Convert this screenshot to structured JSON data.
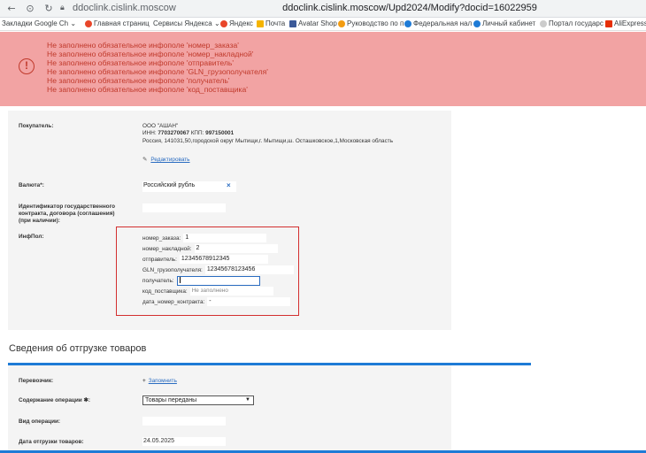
{
  "browser": {
    "url_host": "ddoclink.cislink.moscow",
    "url_full": "ddoclink.cislink.moscow/Upd2024/Modify?docid=16022959"
  },
  "bookmarks": [
    {
      "label": "Закладки Google Ch",
      "color": "#ffffff"
    },
    {
      "label": "Главная страниц",
      "color": "#e8462a"
    },
    {
      "label": "Сервисы Яндекса",
      "color": "#ffffff"
    },
    {
      "label": "Яндекс",
      "color": "#e8462a"
    },
    {
      "label": "Почта",
      "color": "#f5b400"
    },
    {
      "label": "Avatar Shop",
      "color": "#3b5998"
    },
    {
      "label": "Руководство по п",
      "color": "#f39c12"
    },
    {
      "label": "Федеральная нал",
      "color": "#1e7bd6"
    },
    {
      "label": "Личный кабинет",
      "color": "#1e7bd6"
    },
    {
      "label": "Портал государс",
      "color": "#cccccc"
    },
    {
      "label": "AliExpress -",
      "color": "#e62e04"
    }
  ],
  "errors": [
    "Не заполнено обязательное инфополе 'номер_заказа'",
    "Не заполнено обязательное инфополе 'номер_накладной'",
    "Не заполнено обязательное инфополе 'отправитель'",
    "Не заполнено обязательное инфополе 'GLN_грузополучателя'",
    "Не заполнено обязательное инфополе 'получатель'",
    "Не заполнено обязательное инфополе 'код_поставщика'"
  ],
  "buyer": {
    "label": "Покупатель:",
    "name": "ООО \"АШАН\"",
    "inn_label": "ИНН: ",
    "inn": "7703270067",
    "kpp_label": " КПП: ",
    "kpp": "997150001",
    "address": "Россия, 141031,50,городской округ Мытищи,г. Мытищи,ш. Осташковское,1,Московская область",
    "edit_label": "Редактировать"
  },
  "currency": {
    "label": "Валюта*:",
    "value": "Российский рубль",
    "clear": "×"
  },
  "contract": {
    "label_1": "Идентификатор государственного",
    "label_2": "контракта, договора (соглашения)",
    "label_3": "(при наличии):"
  },
  "infopol": {
    "label": "ИнфПол:",
    "fields": [
      {
        "key": "номер_заказа:",
        "value": "1"
      },
      {
        "key": "номер_накладной:",
        "value": "2"
      },
      {
        "key": "отправитель:",
        "value": "12345678912345"
      },
      {
        "key": "GLN_грузополучателя:",
        "value": "12345678123456"
      },
      {
        "key": "получатель:",
        "value": ""
      },
      {
        "key": "код_поставщика:",
        "value": "",
        "placeholder": "Не заполнено"
      },
      {
        "key": "дата_номер_контракта:",
        "value": "-"
      }
    ]
  },
  "shipment": {
    "title": "Сведения об отгрузке товаров",
    "carrier_label": "Перевозчик:",
    "carrier_link": "Запомнить",
    "operation_label": "Содержание операции ✱:",
    "operation_value": "Товары переданы",
    "op_type_label": "Вид операции:",
    "ship_date_label": "Дата отгрузки товаров:",
    "ship_date": "24.05.2025"
  }
}
